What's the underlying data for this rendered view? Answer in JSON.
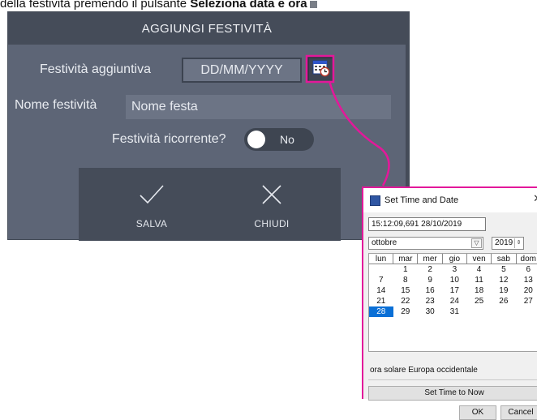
{
  "instruction": {
    "text_before": "della festività premendo il pulsante ",
    "bold_text": "Seleziona data e ora"
  },
  "dialog": {
    "title": "AGGIUNGI FESTIVITÀ",
    "date_label": "Festività aggiuntiva",
    "date_placeholder": "DD/MM/YYYY",
    "name_label": "Nome festività",
    "name_placeholder": "Nome festa",
    "recurring_label": "Festività ricorrente?",
    "recurring_value": "No",
    "save_label": "SALVA",
    "close_label": "CHIUDI"
  },
  "picker": {
    "title": "Set Time and Date",
    "datetime_value": "15:12:09,691 28/10/2019",
    "month": "ottobre",
    "year": "2019",
    "weekdays": [
      "lun",
      "mar",
      "mer",
      "gio",
      "ven",
      "sab",
      "dom"
    ],
    "weeks": [
      [
        "",
        "1",
        "2",
        "3",
        "4",
        "5",
        "6"
      ],
      [
        "7",
        "8",
        "9",
        "10",
        "11",
        "12",
        "13"
      ],
      [
        "14",
        "15",
        "16",
        "17",
        "18",
        "19",
        "20"
      ],
      [
        "21",
        "22",
        "23",
        "24",
        "25",
        "26",
        "27"
      ],
      [
        "28",
        "29",
        "30",
        "31",
        "",
        "",
        ""
      ]
    ],
    "selected_day": "28",
    "timezone": "ora solare Europa occidentale",
    "set_now_label": "Set Time to Now",
    "ok_label": "OK",
    "cancel_label": "Cancel"
  },
  "colors": {
    "dialog_bg": "#5d6576",
    "header_bg": "#454c59",
    "callout": "#e3189a",
    "selected_day": "#0a6fd6"
  }
}
